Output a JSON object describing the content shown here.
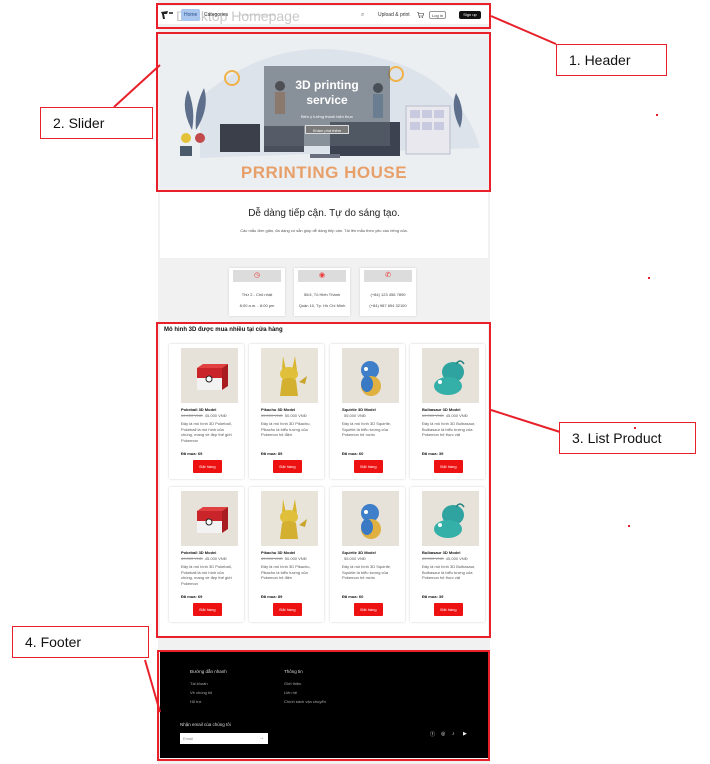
{
  "doc_title": "Desktop Homepage",
  "header": {
    "nav_home": "Home",
    "nav_categories": "Categories",
    "search_placeholder": "Search for products",
    "upload": "Upload & print",
    "login": "Log in",
    "signup": "Sign up"
  },
  "slider": {
    "title_line1": "3D printing",
    "title_line2": "service",
    "subtitle": "Biến ý tưởng thành hiện thực",
    "button": "Khám phá thêm",
    "brand": "PRRINTING HOUSE"
  },
  "intro": {
    "tagline": "Dễ dàng tiếp cận. Tự do sáng tạo.",
    "description": "Các mẫu đơn giản, đa dạng có sẵn giúp dễ dàng tiếp cận. Tải lên mẫu theo yêu cầu riêng của."
  },
  "info_cards": [
    {
      "icon": "clock-icon",
      "line1": "Thứ 2 - Chủ nhật",
      "line2": "8:00 a.m. - 8:00 pm"
    },
    {
      "icon": "location-icon",
      "line1": "50/4, Tô Hiến Thành",
      "line2": "Quận 10, Tp. Hồ Chí Minh"
    },
    {
      "icon": "phone-icon",
      "line1": "(+84) 123 456 7890",
      "line2": "(+84) 987 654 32100"
    }
  ],
  "products_title": "Mô hình 3D được mua nhiều tại cửa hàng",
  "products": [
    {
      "name": "Pokeball 3D Model",
      "old_price": "60.000 VNĐ",
      "price": "45.000 VNĐ",
      "desc": "Đây là mô hình 3D Pokeball, Pokeball là mô hình của chúng, mang về đẹp thế giới Pokemon",
      "sold": "Đã mua: 69",
      "button": "Đặt hàng",
      "img": "pokeball"
    },
    {
      "name": "Pikachu 3D Model",
      "old_price": "65.000 VNĐ",
      "price": "50.000 VNĐ",
      "desc": "Đây là mô hình 3D Pikachu, Pikachu là biểu tượng của Pokemon hệ điện",
      "sold": "Đã mua: 89",
      "button": "Đặt hàng",
      "img": "pikachu"
    },
    {
      "name": "Squirtle 3D Model",
      "old_price": "",
      "price": "55.000 VNĐ",
      "desc": "Đây là mô hình 3D Squirtle, Squirtle là biểu tượng của Pokemon hệ nước",
      "sold": "Đã mua: 60",
      "button": "Đặt hàng",
      "img": "squirtle"
    },
    {
      "name": "Bulbasaur 3D Model",
      "old_price": "60.000 VNĐ",
      "price": "45.000 VNĐ",
      "desc": "Đây là mô hình 3D Bulbasaur, Bulbasaur là biểu tượng của Pokemon hệ thực vật",
      "sold": "Đã mua: 39",
      "button": "Đặt hàng",
      "img": "bulbasaur"
    },
    {
      "name": "Pokeball 3D Model",
      "old_price": "60.000 VNĐ",
      "price": "45.000 VNĐ",
      "desc": "Đây là mô hình 3D Pokeball, Pokeball là mô hình của chúng, mang về đẹp thế giới Pokemon",
      "sold": "Đã mua: 69",
      "button": "Đặt hàng",
      "img": "pokeball"
    },
    {
      "name": "Pikachu 3D Model",
      "old_price": "65.000 VNĐ",
      "price": "50.000 VNĐ",
      "desc": "Đây là mô hình 3D Pikachu, Pikachu là biểu tượng của Pokemon hệ điện",
      "sold": "Đã mua: 89",
      "button": "Đặt hàng",
      "img": "pikachu"
    },
    {
      "name": "Squirtle 3D Model",
      "old_price": "",
      "price": "55.000 VNĐ",
      "desc": "Đây là mô hình 3D Squirtle, Squirtle là biểu tượng của Pokemon hệ nước",
      "sold": "Đã mua: 60",
      "button": "Đặt hàng",
      "img": "squirtle"
    },
    {
      "name": "Bulbasaur 3D Model",
      "old_price": "60.000 VNĐ",
      "price": "45.000 VNĐ",
      "desc": "Đây là mô hình 3D Bulbasaur, Bulbasaur là biểu tượng của Pokemon hệ thực vật",
      "sold": "Đã mua: 39",
      "button": "Đặt hàng",
      "img": "bulbasaur"
    }
  ],
  "footer": {
    "col1_title": "Đường dẫn nhanh",
    "col1_items": [
      "Tài khoản",
      "Về chúng tôi",
      "Hỗ trợ"
    ],
    "col2_title": "Thông tin",
    "col2_items": [
      "Giới thiệu",
      "Liên hệ",
      "Chính sách vận chuyển"
    ],
    "newsletter_label": "Nhận email của chúng tôi",
    "email_placeholder": "Email",
    "social_icons": [
      "facebook-icon",
      "instagram-icon",
      "tiktok-icon",
      "youtube-icon"
    ]
  },
  "annotations": {
    "header": "1. Header",
    "slider": "2. Slider",
    "list_product": "3. List Product",
    "footer": "4. Footer"
  },
  "colors": {
    "annotation": "#e8202a",
    "button": "#ee1111",
    "brand": "#e8a06a"
  }
}
